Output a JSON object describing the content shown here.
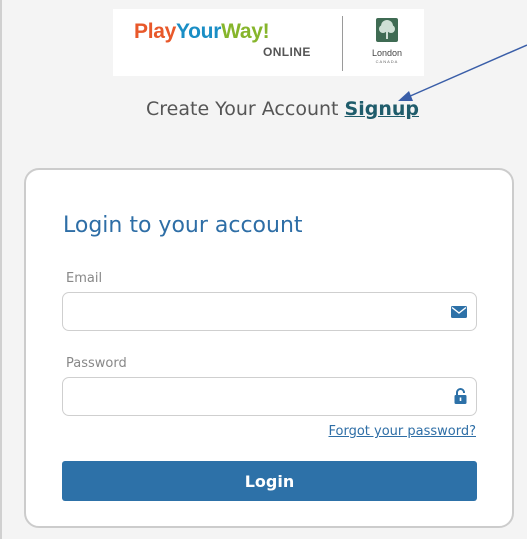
{
  "branding": {
    "logo_part1": "Play",
    "logo_part2": "Your",
    "logo_part3": "Way!",
    "logo_subtitle": "ONLINE",
    "city_name": "London",
    "city_country": "CANADA"
  },
  "signup": {
    "prompt_text": "Create Your Account",
    "link_label": "Signup"
  },
  "login_form": {
    "title": "Login to your account",
    "email_label": "Email",
    "email_value": "",
    "email_placeholder": "",
    "email_icon": "envelope-icon",
    "password_label": "Password",
    "password_value": "",
    "password_placeholder": "",
    "password_icon": "lock-icon",
    "forgot_label": "Forgot your password?",
    "submit_label": "Login"
  },
  "colors": {
    "accent": "#2d71a8",
    "title": "#2e6ea6",
    "signup_link": "#1f5c6b",
    "annotation_arrow": "#3a5ea8"
  }
}
